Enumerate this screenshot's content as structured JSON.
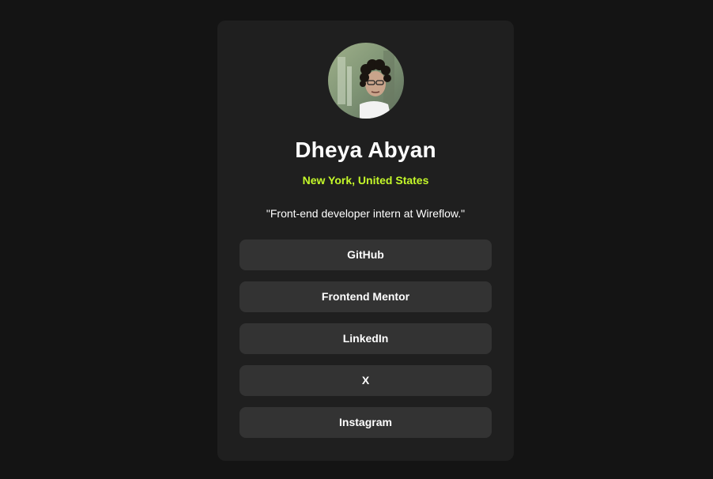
{
  "profile": {
    "name": "Dheya Abyan",
    "location": "New York, United States",
    "bio": "\"Front-end developer intern at Wireflow.\""
  },
  "links": [
    {
      "label": "GitHub"
    },
    {
      "label": "Frontend Mentor"
    },
    {
      "label": "LinkedIn"
    },
    {
      "label": "X"
    },
    {
      "label": "Instagram"
    }
  ],
  "colors": {
    "page_background": "#141414",
    "card_background": "#1f1f1f",
    "button_background": "#333333",
    "accent": "#c4f82a",
    "text": "#ffffff"
  }
}
